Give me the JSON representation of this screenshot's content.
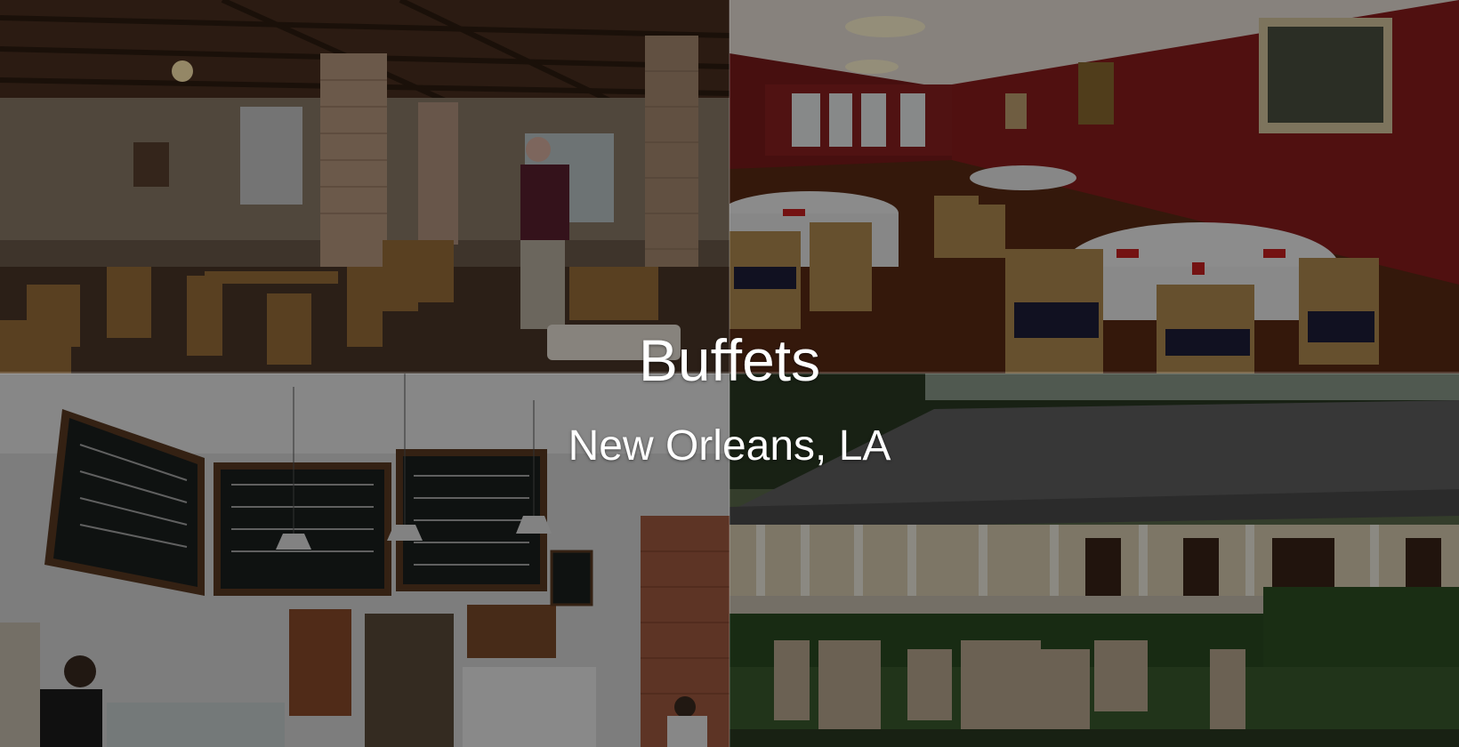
{
  "heading": {
    "title": "Buffets",
    "subtitle": "New Orleans, LA"
  },
  "photos": [
    {
      "scene": "cafe-interior-wood-brick"
    },
    {
      "scene": "red-dining-room"
    },
    {
      "scene": "coffee-shop-chalkboards"
    },
    {
      "scene": "plantation-house-patio"
    }
  ]
}
